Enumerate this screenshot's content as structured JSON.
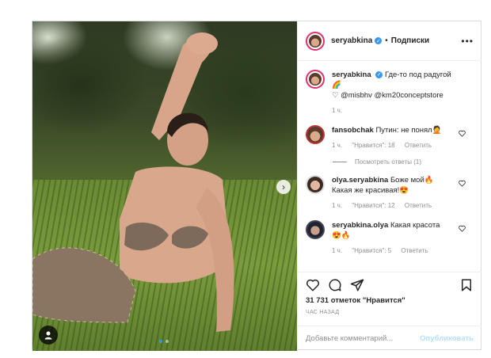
{
  "post": {
    "author": "seryabkina",
    "follow_label": "Подписки",
    "separator": "•",
    "more_icon": "more-horizontal-icon"
  },
  "caption": {
    "author": "seryabkina",
    "text": "Где-то под радугой 🌈",
    "mentions": "♡ @misbhv @km20conceptstore",
    "time": "1 ч."
  },
  "comments": [
    {
      "author": "fansobchak",
      "text": "Путин: не понял🤦",
      "time": "1 ч.",
      "likes": "\"Нравится\": 18",
      "reply": "Ответить",
      "view_replies": "Посмотреть ответы (1)"
    },
    {
      "author": "olya.seryabkina",
      "text": "Боже мой🔥",
      "text2": "Какая же красивая!😍",
      "time": "1 ч.",
      "likes": "\"Нравится\": 12",
      "reply": "Ответить"
    },
    {
      "author": "seryabkina.olya",
      "text": "Какая красота",
      "text2": "😍🔥",
      "time": "1 ч.",
      "likes": "\"Нравится\": 5",
      "reply": "Ответить"
    }
  ],
  "actions": {
    "likes_count": "31 731 отметок \"Нравится\"",
    "timestamp": "ЧАС НАЗАД"
  },
  "add_comment": {
    "placeholder": "Добавьте комментарий...",
    "post_label": "Опубликовать"
  },
  "carousel": {
    "total": 2,
    "current": 1
  },
  "colors": {
    "accent": "#3897f0",
    "border": "#dbdbdb",
    "muted": "#8e8e8e",
    "post_disabled": "#b2dffc"
  }
}
